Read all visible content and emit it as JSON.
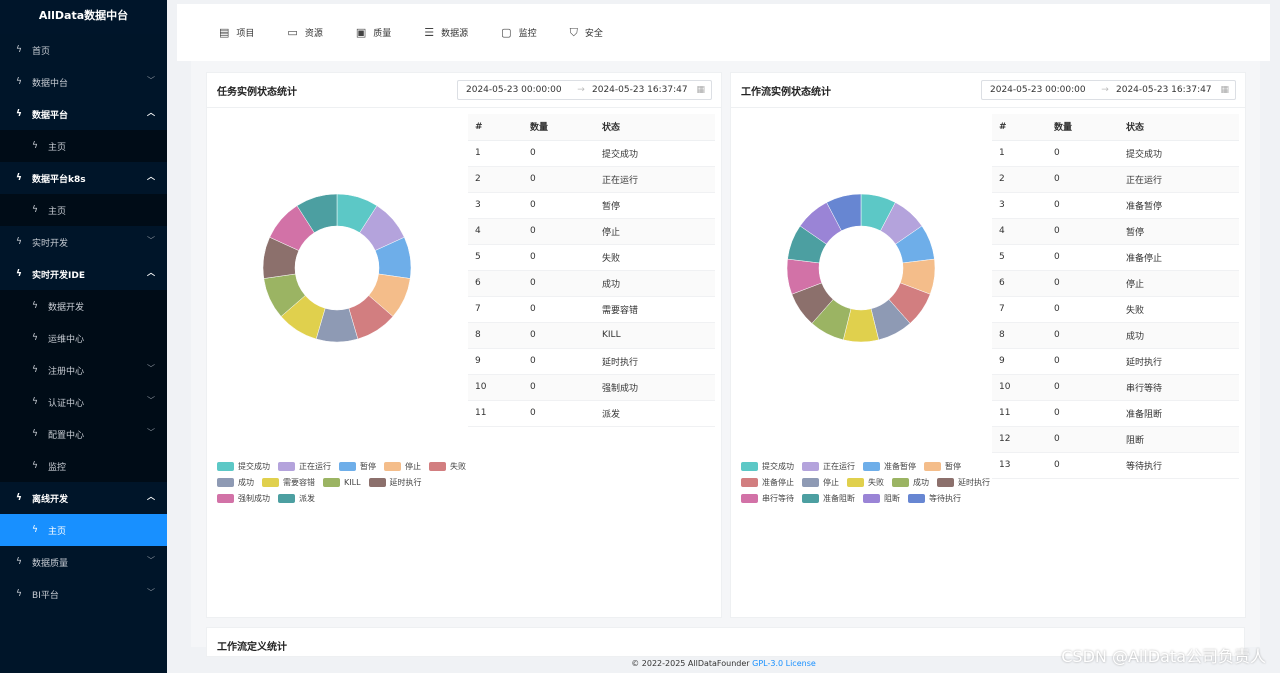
{
  "sidebar": {
    "brand": "AllData数据中台",
    "items": [
      {
        "label": "首页",
        "level": 0
      },
      {
        "label": "数据中台",
        "level": 0,
        "arrow": "down"
      },
      {
        "label": "数据平台",
        "level": 0,
        "arrow": "up",
        "open": true
      },
      {
        "label": "主页",
        "level": 1
      },
      {
        "label": "数据平台k8s",
        "level": 0,
        "arrow": "up",
        "open": true
      },
      {
        "label": "主页",
        "level": 1
      },
      {
        "label": "实时开发",
        "level": 0,
        "arrow": "down"
      },
      {
        "label": "实时开发IDE",
        "level": 0,
        "arrow": "up",
        "open": true
      },
      {
        "label": "数据开发",
        "level": 1
      },
      {
        "label": "运维中心",
        "level": 1
      },
      {
        "label": "注册中心",
        "level": 1,
        "arrow": "down"
      },
      {
        "label": "认证中心",
        "level": 1,
        "arrow": "down"
      },
      {
        "label": "配置中心",
        "level": 1,
        "arrow": "down"
      },
      {
        "label": "监控",
        "level": 1
      },
      {
        "label": "离线开发",
        "level": 0,
        "arrow": "up",
        "open": true
      },
      {
        "label": "主页",
        "level": 1,
        "active": true
      },
      {
        "label": "数据质量",
        "level": 0,
        "arrow": "down"
      },
      {
        "label": "BI平台",
        "level": 0,
        "arrow": "down"
      }
    ]
  },
  "topnav": [
    {
      "label": "项目",
      "icon": "project-icon",
      "glyph": "▤"
    },
    {
      "label": "资源",
      "icon": "folder-icon",
      "glyph": "▭"
    },
    {
      "label": "质量",
      "icon": "quality-icon",
      "glyph": "▣"
    },
    {
      "label": "数据源",
      "icon": "datasource-icon",
      "glyph": "☰"
    },
    {
      "label": "监控",
      "icon": "monitor-icon",
      "glyph": "▢"
    },
    {
      "label": "安全",
      "icon": "shield-icon",
      "glyph": "⛉"
    }
  ],
  "task_card": {
    "title": "任务实例状态统计",
    "start": "2024-05-23 00:00:00",
    "end": "2024-05-23 16:37:47",
    "table_headers": [
      "#",
      "数量",
      "状态"
    ],
    "rows": [
      [
        "1",
        "0",
        "提交成功"
      ],
      [
        "2",
        "0",
        "正在运行"
      ],
      [
        "3",
        "0",
        "暂停"
      ],
      [
        "4",
        "0",
        "停止"
      ],
      [
        "5",
        "0",
        "失败"
      ],
      [
        "6",
        "0",
        "成功"
      ],
      [
        "7",
        "0",
        "需要容错"
      ],
      [
        "8",
        "0",
        "KILL"
      ],
      [
        "9",
        "0",
        "延时执行"
      ],
      [
        "10",
        "0",
        "强制成功"
      ],
      [
        "11",
        "0",
        "派发"
      ]
    ],
    "legend": [
      {
        "label": "提交成功",
        "color": "#5cc8c6"
      },
      {
        "label": "正在运行",
        "color": "#b4a3dc"
      },
      {
        "label": "暂停",
        "color": "#6eaee9"
      },
      {
        "label": "停止",
        "color": "#f4bd8a"
      },
      {
        "label": "失败",
        "color": "#d27e80"
      },
      {
        "label": "成功",
        "color": "#8e9ab4"
      },
      {
        "label": "需要容错",
        "color": "#e0d04d"
      },
      {
        "label": "KILL",
        "color": "#9bb463"
      },
      {
        "label": "延时执行",
        "color": "#8c706c"
      },
      {
        "label": "强制成功",
        "color": "#d272a7"
      },
      {
        "label": "派发",
        "color": "#4c9fa1"
      }
    ]
  },
  "workflow_card": {
    "title": "工作流实例状态统计",
    "start": "2024-05-23 00:00:00",
    "end": "2024-05-23 16:37:47",
    "table_headers": [
      "#",
      "数量",
      "状态"
    ],
    "rows": [
      [
        "1",
        "0",
        "提交成功"
      ],
      [
        "2",
        "0",
        "正在运行"
      ],
      [
        "3",
        "0",
        "准备暂停"
      ],
      [
        "4",
        "0",
        "暂停"
      ],
      [
        "5",
        "0",
        "准备停止"
      ],
      [
        "6",
        "0",
        "停止"
      ],
      [
        "7",
        "0",
        "失败"
      ],
      [
        "8",
        "0",
        "成功"
      ],
      [
        "9",
        "0",
        "延时执行"
      ],
      [
        "10",
        "0",
        "串行等待"
      ],
      [
        "11",
        "0",
        "准备阻断"
      ],
      [
        "12",
        "0",
        "阻断"
      ],
      [
        "13",
        "0",
        "等待执行"
      ]
    ],
    "legend": [
      {
        "label": "提交成功",
        "color": "#5cc8c6"
      },
      {
        "label": "正在运行",
        "color": "#b4a3dc"
      },
      {
        "label": "准备暂停",
        "color": "#6eaee9"
      },
      {
        "label": "暂停",
        "color": "#f4bd8a"
      },
      {
        "label": "准备停止",
        "color": "#d27e80"
      },
      {
        "label": "停止",
        "color": "#8e9ab4"
      },
      {
        "label": "失败",
        "color": "#e0d04d"
      },
      {
        "label": "成功",
        "color": "#9bb463"
      },
      {
        "label": "延时执行",
        "color": "#8c706c"
      },
      {
        "label": "串行等待",
        "color": "#d272a7"
      },
      {
        "label": "准备阻断",
        "color": "#4c9fa1"
      },
      {
        "label": "阻断",
        "color": "#9a84d6"
      },
      {
        "label": "等待执行",
        "color": "#6786d2"
      }
    ]
  },
  "bottom_card_title": "工作流定义统计",
  "footer": {
    "text": "© 2022-2025 AllDataFounder ",
    "license": "GPL-3.0 License"
  },
  "watermark": "CSDN @AllData公司负责人"
}
